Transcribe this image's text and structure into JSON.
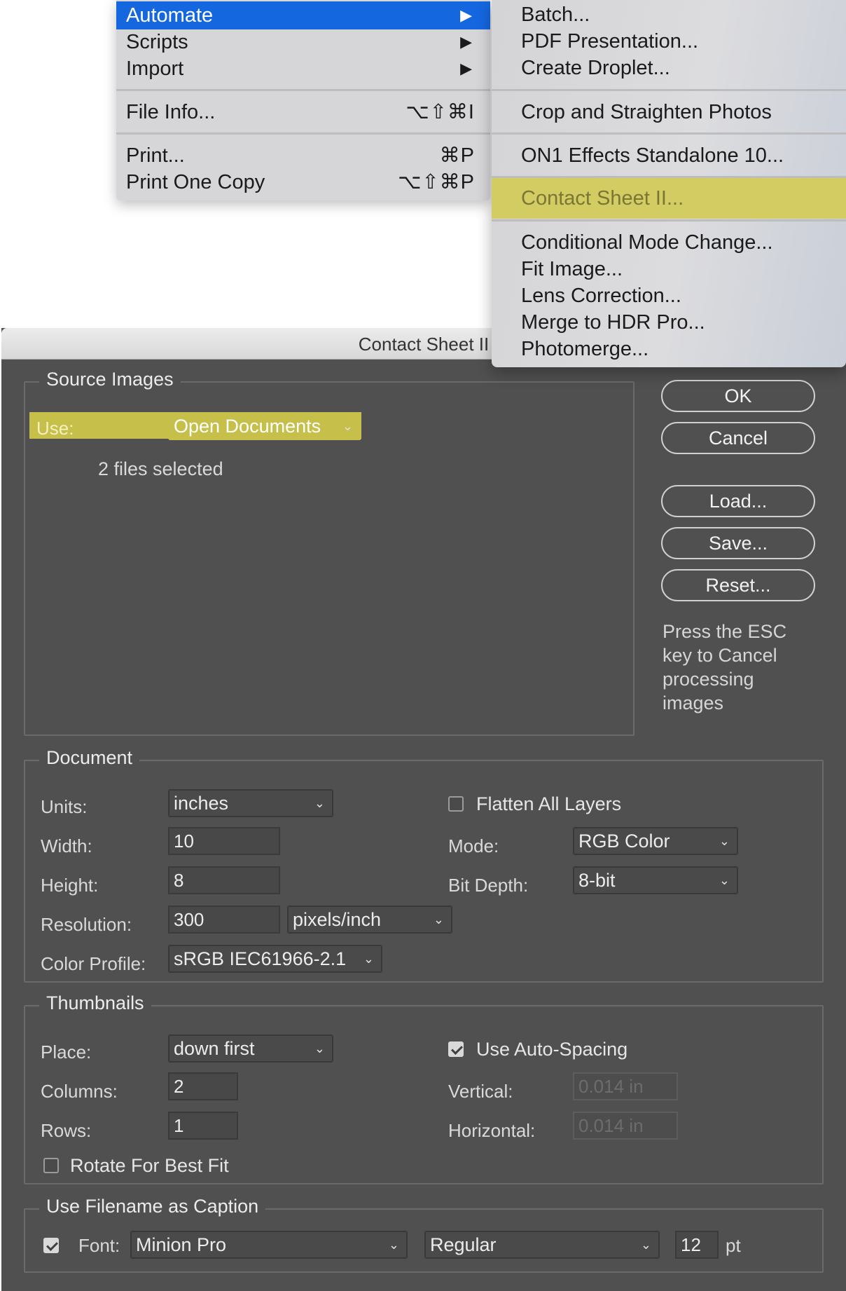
{
  "file_menu": {
    "items": [
      {
        "label": "Automate",
        "arrow": "▶"
      },
      {
        "label": "Scripts",
        "arrow": "▶"
      },
      {
        "label": "Import",
        "arrow": "▶"
      },
      {
        "label": "File Info...",
        "shortcut": "⌥⇧⌘I"
      },
      {
        "label": "Print...",
        "shortcut": "⌘P"
      },
      {
        "label": "Print One Copy",
        "shortcut": "⌥⇧⌘P"
      }
    ]
  },
  "automate_menu": {
    "items": [
      "Batch...",
      "PDF Presentation...",
      "Create Droplet...",
      "Crop and Straighten Photos",
      "ON1 Effects Standalone 10...",
      "Contact Sheet II...",
      "Conditional Mode Change...",
      "Fit Image...",
      "Lens Correction...",
      "Merge to HDR Pro...",
      "Photomerge..."
    ]
  },
  "dialog": {
    "title": "Contact Sheet II",
    "source": {
      "title": "Source Images",
      "use_label": "Use:",
      "use_value": "Open Documents",
      "files_selected": "2 files selected"
    },
    "buttons": {
      "ok": "OK",
      "cancel": "Cancel",
      "load": "Load...",
      "save": "Save...",
      "reset": "Reset..."
    },
    "hint": "Press the ESC key to Cancel processing images",
    "document": {
      "title": "Document",
      "units_label": "Units:",
      "units_value": "inches",
      "width_label": "Width:",
      "width_value": "10",
      "height_label": "Height:",
      "height_value": "8",
      "resolution_label": "Resolution:",
      "resolution_value": "300",
      "resolution_unit": "pixels/inch",
      "profile_label": "Color Profile:",
      "profile_value": "sRGB IEC61966-2.1",
      "flatten_label": "Flatten All Layers",
      "flatten_checked": false,
      "mode_label": "Mode:",
      "mode_value": "RGB Color",
      "bitdepth_label": "Bit Depth:",
      "bitdepth_value": "8-bit"
    },
    "thumbnails": {
      "title": "Thumbnails",
      "place_label": "Place:",
      "place_value": "down first",
      "columns_label": "Columns:",
      "columns_value": "2",
      "rows_label": "Rows:",
      "rows_value": "1",
      "rotate_label": "Rotate For Best Fit",
      "rotate_checked": false,
      "autospacing_label": "Use Auto-Spacing",
      "autospacing_checked": true,
      "vertical_label": "Vertical:",
      "vertical_value": "0.014 in",
      "horizontal_label": "Horizontal:",
      "horizontal_value": "0.014 in"
    },
    "caption": {
      "title": "Use Filename as Caption",
      "enabled": true,
      "font_label": "Font:",
      "font_value": "Minion Pro",
      "style_value": "Regular",
      "size_value": "12",
      "size_unit": "pt"
    }
  },
  "colors": {
    "menu_highlight": "#1567e0",
    "yellow_highlight": "#d3cc62",
    "dialog_bg": "#505050"
  }
}
